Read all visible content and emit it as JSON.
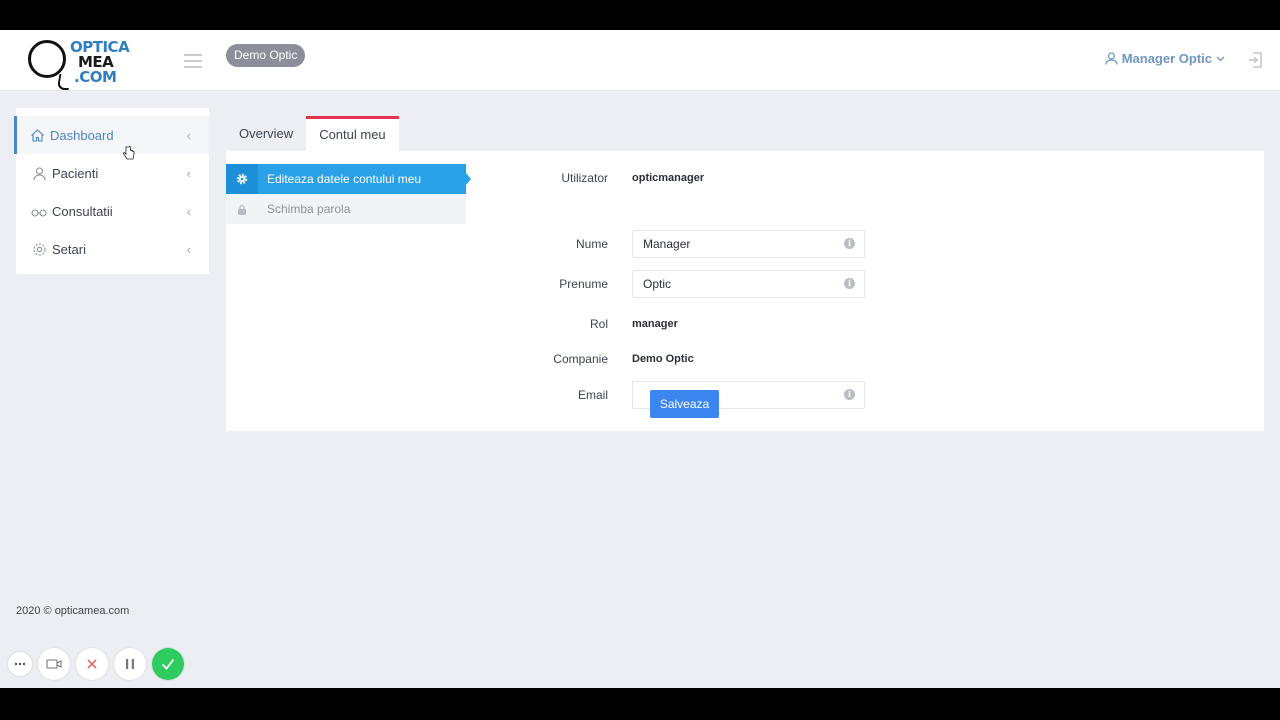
{
  "header": {
    "logo_lines": [
      "OPTICA",
      "MEA",
      ".COM"
    ],
    "company_badge": "Demo Optic",
    "user_menu_label": "Manager Optic"
  },
  "sidebar": {
    "items": [
      {
        "label": "Dashboard",
        "icon": "home-icon",
        "active": true
      },
      {
        "label": "Pacienti",
        "icon": "user-icon",
        "active": false
      },
      {
        "label": "Consultatii",
        "icon": "glasses-icon",
        "active": false
      },
      {
        "label": "Setari",
        "icon": "gear-icon",
        "active": false
      }
    ]
  },
  "tabs": [
    {
      "label": "Overview",
      "active": false
    },
    {
      "label": "Contul meu",
      "active": true
    }
  ],
  "subnav": [
    {
      "label": "Editeaza datele contului meu",
      "icon": "gear-icon",
      "active": true
    },
    {
      "label": "Schimba parola",
      "icon": "lock-icon",
      "active": false
    }
  ],
  "form": {
    "utilizator_label": "Utilizator",
    "utilizator_value": "opticmanager",
    "nume_label": "Nume",
    "nume_value": "Manager",
    "prenume_label": "Prenume",
    "prenume_value": "Optic",
    "rol_label": "Rol",
    "rol_value": "manager",
    "companie_label": "Companie",
    "companie_value": "Demo Optic",
    "email_label": "Email",
    "email_value": "",
    "save_label": "Salveaza"
  },
  "footer": {
    "copyright": "2020 © opticamea.com"
  },
  "colors": {
    "accent_blue": "#2aa0e8",
    "button_blue": "#3b86f0",
    "active_tab_border": "#e3344f",
    "record_done": "#2ecc5f"
  }
}
